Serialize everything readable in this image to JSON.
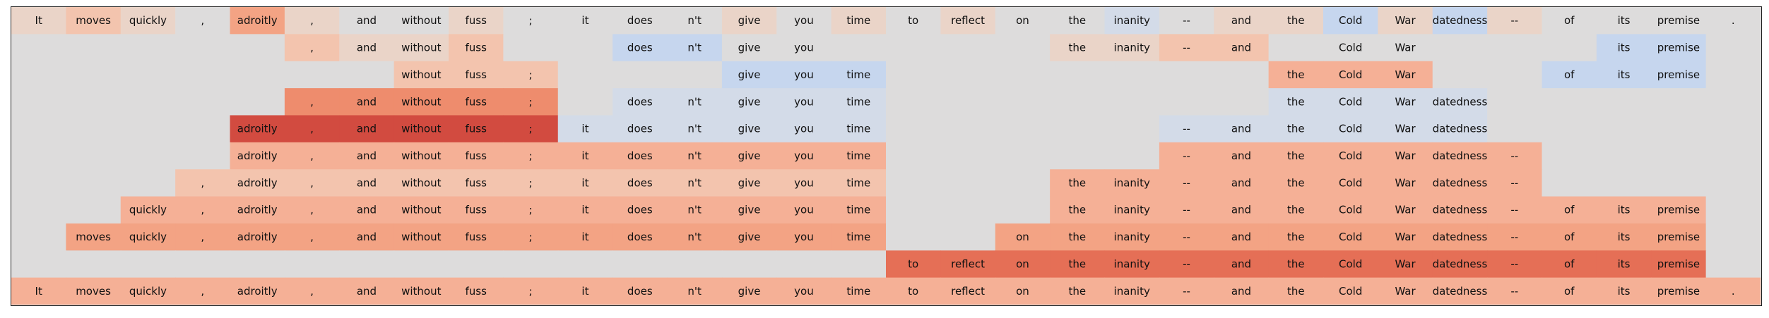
{
  "chart_data": {
    "type": "heatmap",
    "columns": [
      "It",
      "moves",
      "quickly",
      ",",
      "adroitly",
      ",",
      "and",
      "without",
      "fuss",
      ";",
      "it",
      "does",
      "n't",
      "give",
      "you",
      "time",
      "to",
      "reflect",
      "on",
      "the",
      "inanity",
      "--",
      "and",
      "the",
      "Cold",
      "War",
      "datedness",
      "--",
      "of",
      "its",
      "premise",
      "."
    ],
    "colors": {
      "background": "#dddcdc",
      "c0": "#dddcdc",
      "cn2": "#c6d6ee",
      "cn1": "#d3dbe8",
      "p1": "#ead4c8",
      "p2": "#f3c4ae",
      "p3": "#f5b096",
      "p4": "#f3a384",
      "p5": "#ee8c6d",
      "p6": "#e56f56",
      "p7": "#d24b40"
    },
    "rows": [
      [
        "p1",
        "p2",
        "p1",
        "c0",
        "p4",
        "p1",
        "c0",
        "c0",
        "p1",
        "c0",
        "c0",
        "c0",
        "c0",
        "p1",
        "c0",
        "p1",
        "c0",
        "p1",
        "c0",
        "c0",
        "cn1",
        "c0",
        "p1",
        "p1",
        "cn2",
        "p1",
        "cn2",
        "p1",
        "c0",
        "c0",
        "c0",
        "c0"
      ],
      [
        "c0",
        "c0",
        "c0",
        "c0",
        "c0",
        "p2",
        "p1",
        "p1",
        "p2",
        "c0",
        "c0",
        "cn2",
        "cn2",
        "c0",
        "c0",
        "c0",
        "c0",
        "c0",
        "c0",
        "p1",
        "p1",
        "p2",
        "p2",
        "c0",
        "c0",
        "c0",
        "c0",
        "c0",
        "c0",
        "cn2",
        "cn2",
        "c0"
      ],
      [
        "c0",
        "c0",
        "c0",
        "c0",
        "c0",
        "c0",
        "c0",
        "p2",
        "p2",
        "p2",
        "c0",
        "c0",
        "c0",
        "cn2",
        "cn2",
        "cn2",
        "c0",
        "c0",
        "c0",
        "c0",
        "c0",
        "c0",
        "c0",
        "p3",
        "p3",
        "p3",
        "c0",
        "c0",
        "cn2",
        "cn2",
        "cn2",
        "c0"
      ],
      [
        "c0",
        "c0",
        "c0",
        "c0",
        "c0",
        "p5",
        "p5",
        "p5",
        "p5",
        "p5",
        "c0",
        "cn1",
        "cn1",
        "cn1",
        "cn1",
        "cn1",
        "c0",
        "c0",
        "c0",
        "c0",
        "c0",
        "c0",
        "c0",
        "cn1",
        "cn1",
        "cn1",
        "cn1",
        "c0",
        "c0",
        "c0",
        "c0",
        "c0"
      ],
      [
        "c0",
        "c0",
        "c0",
        "c0",
        "p7",
        "p7",
        "p7",
        "p7",
        "p7",
        "p7",
        "cn1",
        "cn1",
        "cn1",
        "cn1",
        "cn1",
        "cn1",
        "c0",
        "c0",
        "c0",
        "c0",
        "c0",
        "cn1",
        "cn1",
        "cn1",
        "cn1",
        "cn1",
        "cn1",
        "c0",
        "c0",
        "c0",
        "c0",
        "c0"
      ],
      [
        "c0",
        "c0",
        "c0",
        "c0",
        "p3",
        "p3",
        "p3",
        "p3",
        "p3",
        "p3",
        "p3",
        "p3",
        "p3",
        "p3",
        "p3",
        "p3",
        "c0",
        "c0",
        "c0",
        "c0",
        "c0",
        "p3",
        "p3",
        "p3",
        "p3",
        "p3",
        "p3",
        "p3",
        "c0",
        "c0",
        "c0",
        "c0"
      ],
      [
        "c0",
        "c0",
        "c0",
        "p2",
        "p2",
        "p2",
        "p2",
        "p2",
        "p2",
        "p2",
        "p2",
        "p2",
        "p2",
        "p2",
        "p2",
        "p2",
        "c0",
        "c0",
        "c0",
        "p3",
        "p3",
        "p3",
        "p3",
        "p3",
        "p3",
        "p3",
        "p3",
        "p3",
        "c0",
        "c0",
        "c0",
        "c0"
      ],
      [
        "c0",
        "c0",
        "p3",
        "p3",
        "p3",
        "p3",
        "p3",
        "p3",
        "p3",
        "p3",
        "p3",
        "p3",
        "p3",
        "p3",
        "p3",
        "p3",
        "c0",
        "c0",
        "c0",
        "p3",
        "p3",
        "p3",
        "p3",
        "p3",
        "p3",
        "p3",
        "p3",
        "p3",
        "p3",
        "p3",
        "p3",
        "c0"
      ],
      [
        "c0",
        "p4",
        "p4",
        "p4",
        "p4",
        "p4",
        "p4",
        "p4",
        "p4",
        "p4",
        "p4",
        "p4",
        "p4",
        "p4",
        "p4",
        "p4",
        "c0",
        "c0",
        "p4",
        "p4",
        "p4",
        "p4",
        "p4",
        "p4",
        "p4",
        "p4",
        "p4",
        "p4",
        "p4",
        "p4",
        "p4",
        "c0"
      ],
      [
        "c0",
        "c0",
        "c0",
        "c0",
        "c0",
        "c0",
        "c0",
        "c0",
        "c0",
        "c0",
        "c0",
        "c0",
        "c0",
        "c0",
        "c0",
        "c0",
        "p6",
        "p6",
        "p6",
        "p6",
        "p6",
        "p6",
        "p6",
        "p6",
        "p6",
        "p6",
        "p6",
        "p6",
        "p6",
        "p6",
        "p6",
        "c0"
      ],
      [
        "p3",
        "p3",
        "p3",
        "p3",
        "p3",
        "p3",
        "p3",
        "p3",
        "p3",
        "p3",
        "p3",
        "p3",
        "p3",
        "p3",
        "p3",
        "p3",
        "p3",
        "p3",
        "p3",
        "p3",
        "p3",
        "p3",
        "p3",
        "p3",
        "p3",
        "p3",
        "p3",
        "p3",
        "p3",
        "p3",
        "p3",
        "p3"
      ]
    ],
    "labels_shown": [
      [
        1,
        1,
        1,
        1,
        1,
        1,
        1,
        1,
        1,
        1,
        1,
        1,
        1,
        1,
        1,
        1,
        1,
        1,
        1,
        1,
        1,
        1,
        1,
        1,
        1,
        1,
        1,
        1,
        1,
        1,
        1,
        1
      ],
      [
        0,
        0,
        0,
        0,
        0,
        1,
        1,
        1,
        1,
        0,
        0,
        1,
        1,
        1,
        1,
        0,
        0,
        0,
        0,
        1,
        1,
        1,
        1,
        0,
        1,
        1,
        0,
        0,
        0,
        1,
        1,
        0
      ],
      [
        0,
        0,
        0,
        0,
        0,
        0,
        0,
        1,
        1,
        1,
        0,
        0,
        0,
        1,
        1,
        1,
        0,
        0,
        0,
        0,
        0,
        0,
        0,
        1,
        1,
        1,
        0,
        0,
        1,
        1,
        1,
        0
      ],
      [
        0,
        0,
        0,
        0,
        0,
        1,
        1,
        1,
        1,
        1,
        0,
        1,
        1,
        1,
        1,
        1,
        0,
        0,
        0,
        0,
        0,
        0,
        0,
        1,
        1,
        1,
        1,
        0,
        0,
        0,
        0,
        0
      ],
      [
        0,
        0,
        0,
        0,
        1,
        1,
        1,
        1,
        1,
        1,
        1,
        1,
        1,
        1,
        1,
        1,
        0,
        0,
        0,
        0,
        0,
        1,
        1,
        1,
        1,
        1,
        1,
        0,
        0,
        0,
        0,
        0
      ],
      [
        0,
        0,
        0,
        0,
        1,
        1,
        1,
        1,
        1,
        1,
        1,
        1,
        1,
        1,
        1,
        1,
        0,
        0,
        0,
        0,
        0,
        1,
        1,
        1,
        1,
        1,
        1,
        1,
        0,
        0,
        0,
        0
      ],
      [
        0,
        0,
        0,
        1,
        1,
        1,
        1,
        1,
        1,
        1,
        1,
        1,
        1,
        1,
        1,
        1,
        0,
        0,
        0,
        1,
        1,
        1,
        1,
        1,
        1,
        1,
        1,
        1,
        0,
        0,
        0,
        0
      ],
      [
        0,
        0,
        1,
        1,
        1,
        1,
        1,
        1,
        1,
        1,
        1,
        1,
        1,
        1,
        1,
        1,
        0,
        0,
        0,
        1,
        1,
        1,
        1,
        1,
        1,
        1,
        1,
        1,
        1,
        1,
        1,
        0
      ],
      [
        0,
        1,
        1,
        1,
        1,
        1,
        1,
        1,
        1,
        1,
        1,
        1,
        1,
        1,
        1,
        1,
        0,
        0,
        1,
        1,
        1,
        1,
        1,
        1,
        1,
        1,
        1,
        1,
        1,
        1,
        1,
        0
      ],
      [
        0,
        0,
        0,
        0,
        0,
        0,
        0,
        0,
        0,
        0,
        0,
        0,
        0,
        0,
        0,
        0,
        1,
        1,
        1,
        1,
        1,
        1,
        1,
        1,
        1,
        1,
        1,
        1,
        1,
        1,
        1,
        0
      ],
      [
        1,
        1,
        1,
        1,
        1,
        1,
        1,
        1,
        1,
        1,
        1,
        1,
        1,
        1,
        1,
        1,
        1,
        1,
        1,
        1,
        1,
        1,
        1,
        1,
        1,
        1,
        1,
        1,
        1,
        1,
        1,
        1
      ]
    ],
    "grid": false,
    "legend": "none"
  }
}
